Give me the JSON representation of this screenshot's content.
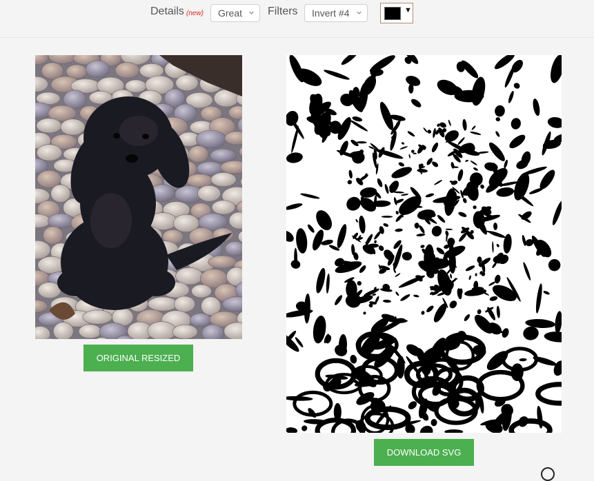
{
  "toolbar": {
    "details_label": "Details",
    "details_new_badge": "(new)",
    "details_value": "Great",
    "filters_label": "Filters",
    "filters_value": "Invert #4",
    "color_value": "#000000"
  },
  "buttons": {
    "original_resized": "ORIGINAL RESIZED",
    "download_svg": "DOWNLOAD SVG"
  },
  "colors": {
    "accent_green": "#4caf50",
    "new_badge_red": "#d9251d"
  },
  "icons": {
    "dropdown_chevron": "chevron-down-icon",
    "color_arrow": "caret-down-icon"
  }
}
